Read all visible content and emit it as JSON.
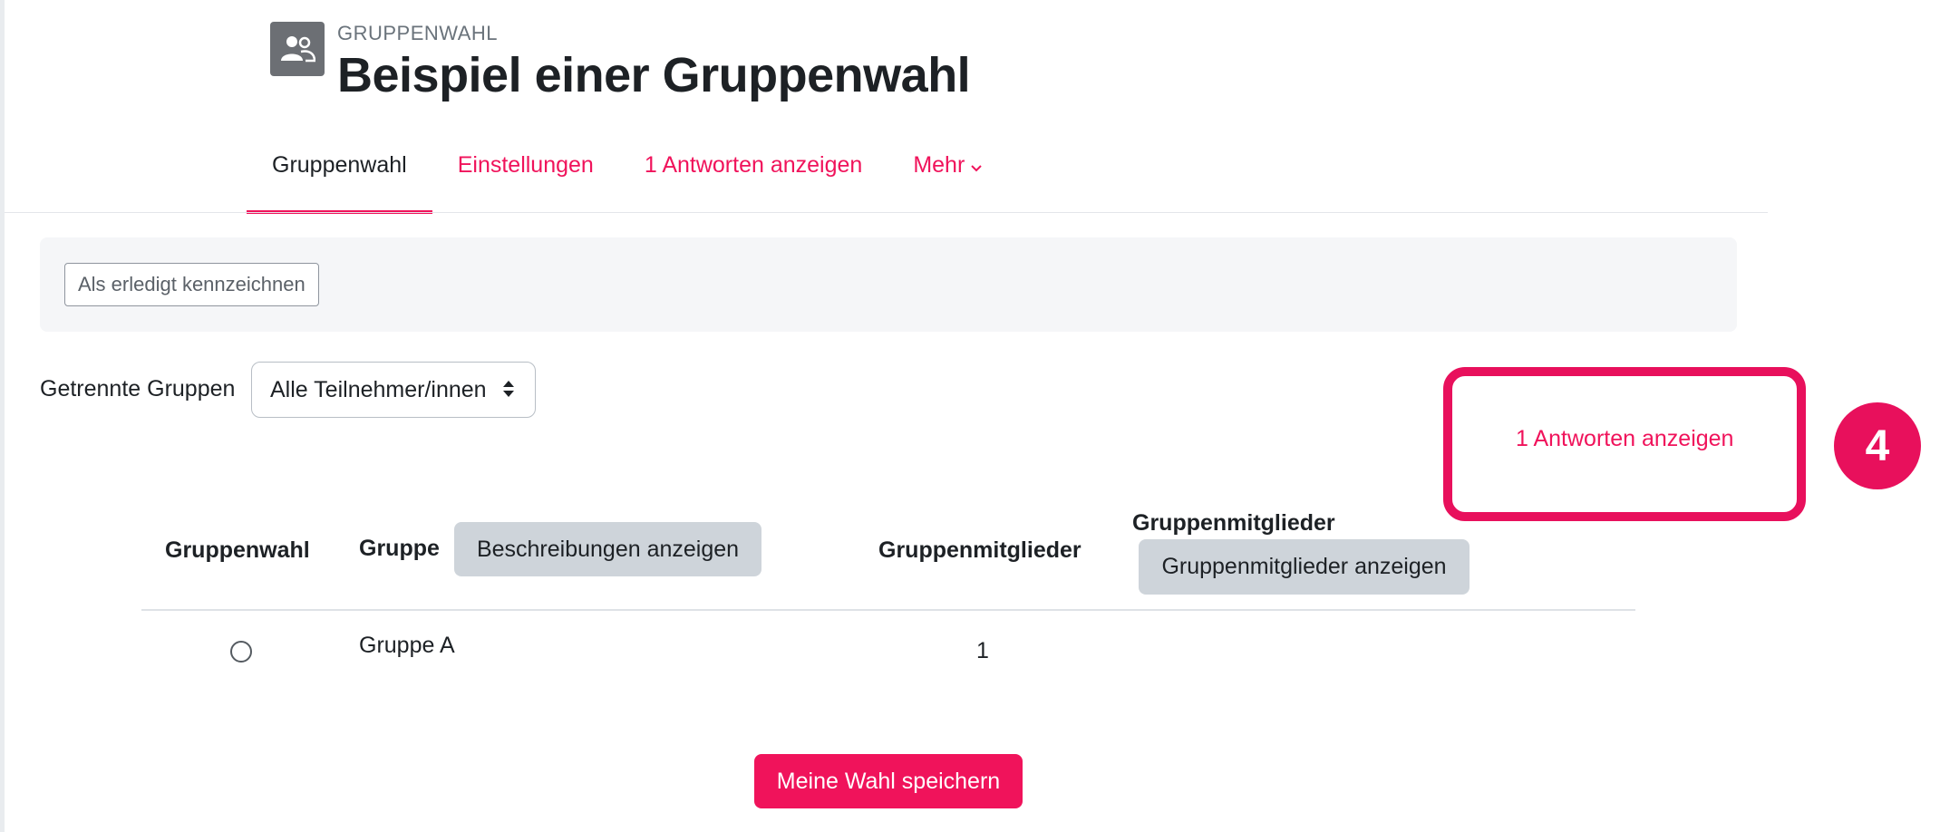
{
  "header": {
    "kicker": "GRUPPENWAHL",
    "title": "Beispiel einer Gruppenwahl",
    "icon": "users-icon"
  },
  "tabs": [
    {
      "label": "Gruppenwahl",
      "active": true
    },
    {
      "label": "Einstellungen",
      "active": false
    },
    {
      "label": "1 Antworten anzeigen",
      "active": false
    },
    {
      "label": "Mehr",
      "active": false
    }
  ],
  "completion": {
    "button_label": "Als erledigt kennzeichnen"
  },
  "groups": {
    "label": "Getrennte Gruppen",
    "selected": "Alle Teilnehmer/innen"
  },
  "responses_link": "1 Antworten anzeigen",
  "annotation": {
    "step": "4",
    "color": "#e8105c"
  },
  "table": {
    "headers": {
      "choice": "Gruppenwahl",
      "group": "Gruppe",
      "show_descriptions": "Beschreibungen anzeigen",
      "members_count": "Gruppenmitglieder",
      "members": "Gruppenmitglieder",
      "show_members": "Gruppenmitglieder anzeigen"
    },
    "rows": [
      {
        "group": "Gruppe A",
        "members_count": "1"
      }
    ]
  },
  "save_button": "Meine Wahl speichern",
  "colors": {
    "accent": "#f0135b",
    "text": "#1d2125",
    "muted": "#6a737b"
  }
}
